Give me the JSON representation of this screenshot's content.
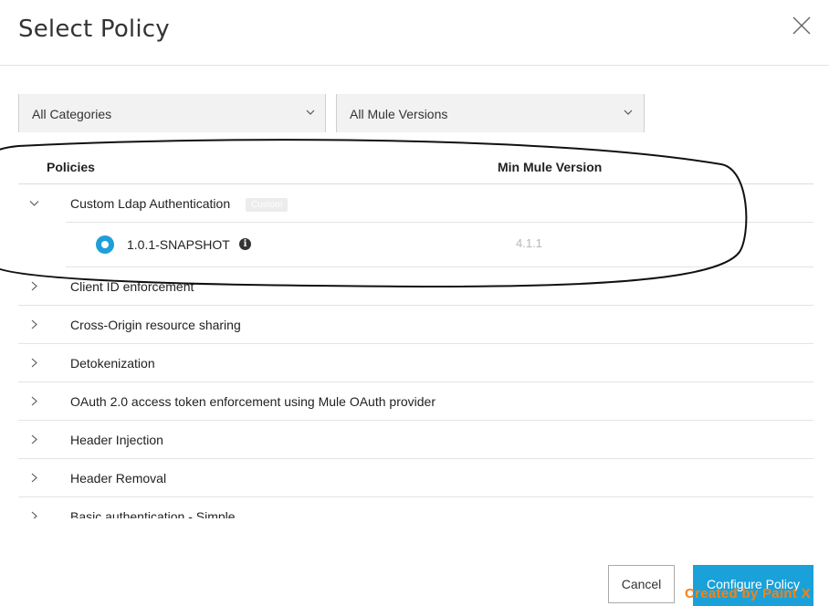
{
  "dialog": {
    "title": "Select Policy",
    "close_icon": "close-icon"
  },
  "filters": {
    "category": {
      "value": "All Categories",
      "icon": "chevron-down-icon"
    },
    "mule_version": {
      "value": "All Mule Versions",
      "icon": "chevron-down-icon"
    }
  },
  "table": {
    "columns": [
      "Policies",
      "Min Mule Version"
    ],
    "expanded_policy": {
      "name": "Custom Ldap Authentication",
      "badge": "Custom",
      "versions": [
        {
          "version": "1.0.1-SNAPSHOT",
          "min_mule_version": "4.1.1",
          "selected": true,
          "info_icon": "info-icon"
        }
      ]
    },
    "policies": [
      "Client ID enforcement",
      "Cross-Origin resource sharing",
      "Detokenization",
      "OAuth 2.0 access token enforcement using Mule OAuth provider",
      "Header Injection",
      "Header Removal",
      "Basic authentication - Simple"
    ]
  },
  "footer": {
    "cancel_label": "Cancel",
    "configure_label": "Configure Policy"
  },
  "watermark": "Created by Paint X",
  "colors": {
    "accent": "#1aa1d9",
    "watermark": "#ff7f0e",
    "annotation": "#111111"
  }
}
